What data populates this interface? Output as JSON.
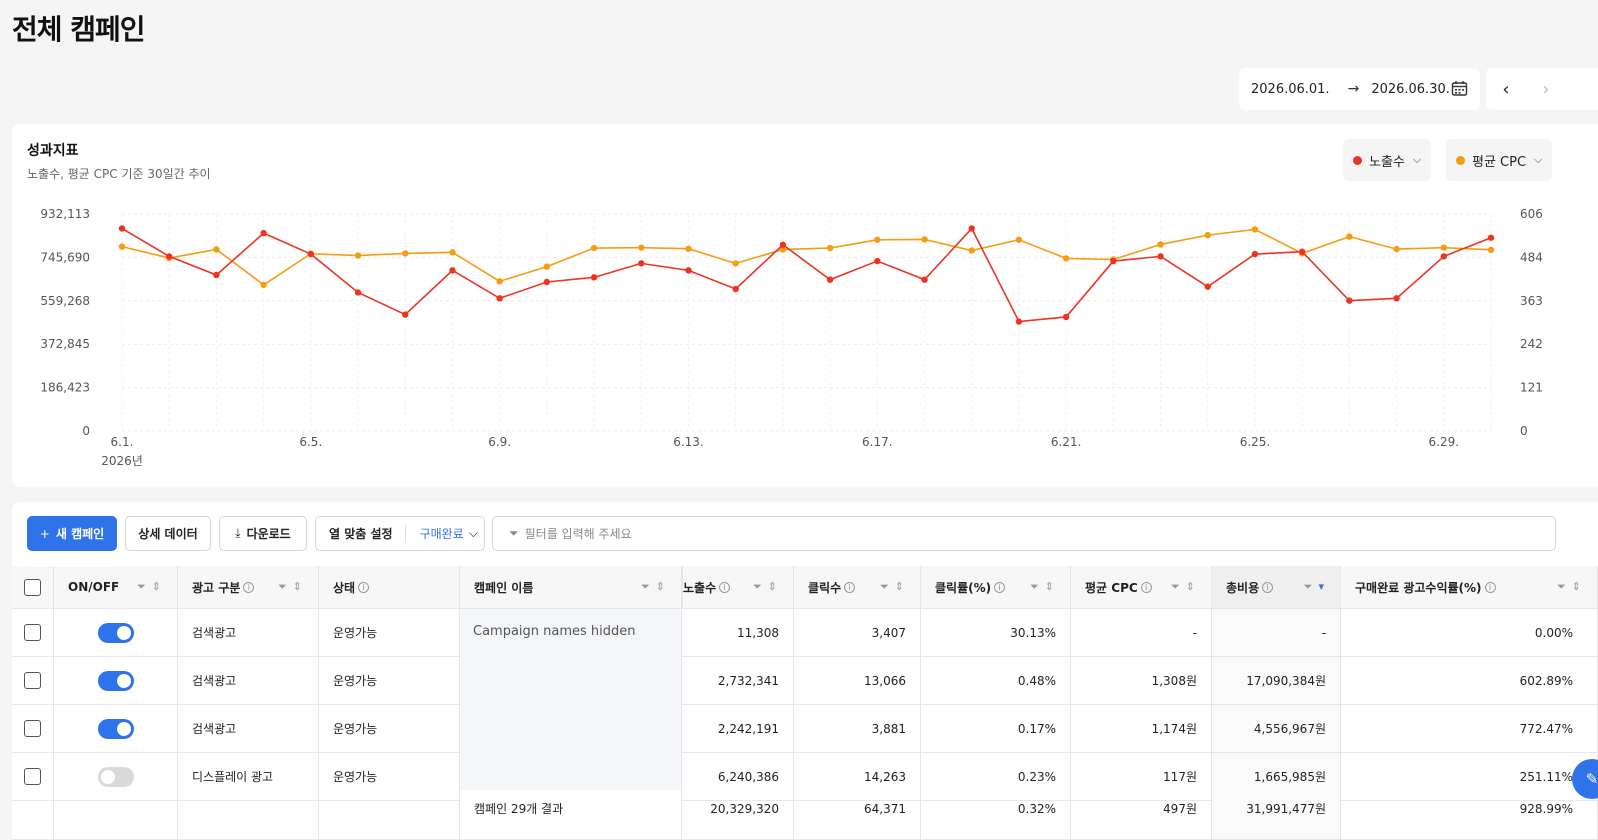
{
  "page_title": "전체 캠페인",
  "date_range": {
    "start": "2026.06.01.",
    "end": "2026.06.30."
  },
  "chart_card": {
    "title": "성과지표",
    "subtitle": "노출수, 평균 CPC 기준 30일간 추이",
    "metric_buttons": [
      {
        "label": "노출수",
        "color": "#ee3322"
      },
      {
        "label": "평균 CPC",
        "color": "#f59c12"
      }
    ]
  },
  "chart_data": {
    "type": "line",
    "x": [
      "6.1.",
      "6.2.",
      "6.3.",
      "6.4.",
      "6.5.",
      "6.6.",
      "6.7.",
      "6.8.",
      "6.9.",
      "6.10.",
      "6.11.",
      "6.12.",
      "6.13.",
      "6.14.",
      "6.15.",
      "6.16.",
      "6.17.",
      "6.18.",
      "6.19.",
      "6.20.",
      "6.21.",
      "6.22.",
      "6.23.",
      "6.24.",
      "6.25.",
      "6.26.",
      "6.27.",
      "6.28.",
      "6.29.",
      "6.30."
    ],
    "x_tick_labels": [
      "6.1.",
      "6.5.",
      "6.9.",
      "6.13.",
      "6.17.",
      "6.21.",
      "6.25.",
      "6.29."
    ],
    "x_year_label": "2026년",
    "y_left_ticks": [
      "0",
      "186,423",
      "372,845",
      "559,268",
      "745,690",
      "932,113"
    ],
    "y_right_ticks": [
      "0",
      "121",
      "242",
      "363",
      "484",
      "606"
    ],
    "y_left_range": [
      0,
      932113
    ],
    "y_right_range": [
      0,
      606
    ],
    "series": [
      {
        "name": "노출수",
        "axis": "left",
        "color": "#ee3322",
        "values": [
          870000,
          750000,
          670000,
          850000,
          760000,
          595000,
          500000,
          690000,
          570000,
          640000,
          660000,
          720000,
          690000,
          610000,
          800000,
          650000,
          730000,
          650000,
          870000,
          470000,
          490000,
          730000,
          750000,
          620000,
          760000,
          770000,
          560000,
          570000,
          750000,
          830000
        ]
      },
      {
        "name": "평균 CPC",
        "axis": "right",
        "color": "#f59c12",
        "values": [
          515,
          483,
          507,
          408,
          495,
          490,
          496,
          499,
          418,
          459,
          511,
          512,
          509,
          468,
          507,
          511,
          534,
          535,
          504,
          534,
          482,
          479,
          521,
          547,
          563,
          496,
          543,
          508,
          512,
          506
        ]
      }
    ],
    "grid": true
  },
  "toolbar": {
    "new_campaign": "새 캠페인",
    "detail_data": "상세 데이터",
    "download": "다운로드",
    "column_setting": "열 맞춤 설정",
    "column_setting_value": "구매완료",
    "filter_placeholder": "필터를 입력해 주세요"
  },
  "table": {
    "headers": {
      "onoff": "ON/OFF",
      "ad_type": "광고 구분",
      "status": "상태",
      "campaign_name": "캠페인 이름",
      "impressions": "노출수",
      "clicks": "클릭수",
      "ctr": "클릭률(%)",
      "avg_cpc": "평균 CPC",
      "total_cost": "총비용",
      "roas": "구매완료 광고수익률(%)"
    },
    "campaign_names_hidden_text": "Campaign names hidden",
    "rows": [
      {
        "on": true,
        "ad_type": "검색광고",
        "status": "운영가능",
        "impressions": "11,308",
        "clicks": "3,407",
        "ctr": "30.13%",
        "avg_cpc": "-",
        "total_cost": "-",
        "roas": "0.00%"
      },
      {
        "on": true,
        "ad_type": "검색광고",
        "status": "운영가능",
        "impressions": "2,732,341",
        "clicks": "13,066",
        "ctr": "0.48%",
        "avg_cpc": "1,308원",
        "total_cost": "17,090,384원",
        "roas": "602.89%"
      },
      {
        "on": true,
        "ad_type": "검색광고",
        "status": "운영가능",
        "impressions": "2,242,191",
        "clicks": "3,881",
        "ctr": "0.17%",
        "avg_cpc": "1,174원",
        "total_cost": "4,556,967원",
        "roas": "772.47%"
      },
      {
        "on": false,
        "ad_type": "디스플레이 광고",
        "status": "운영가능",
        "impressions": "6,240,386",
        "clicks": "14,263",
        "ctr": "0.23%",
        "avg_cpc": "117원",
        "total_cost": "1,665,985원",
        "roas": "251.11%"
      }
    ],
    "summary": {
      "label": "캠페인 29개 결과",
      "impressions": "20,329,320",
      "clicks": "64,371",
      "ctr": "0.32%",
      "avg_cpc": "497원",
      "total_cost": "31,991,477원",
      "roas": "928.99%"
    }
  }
}
